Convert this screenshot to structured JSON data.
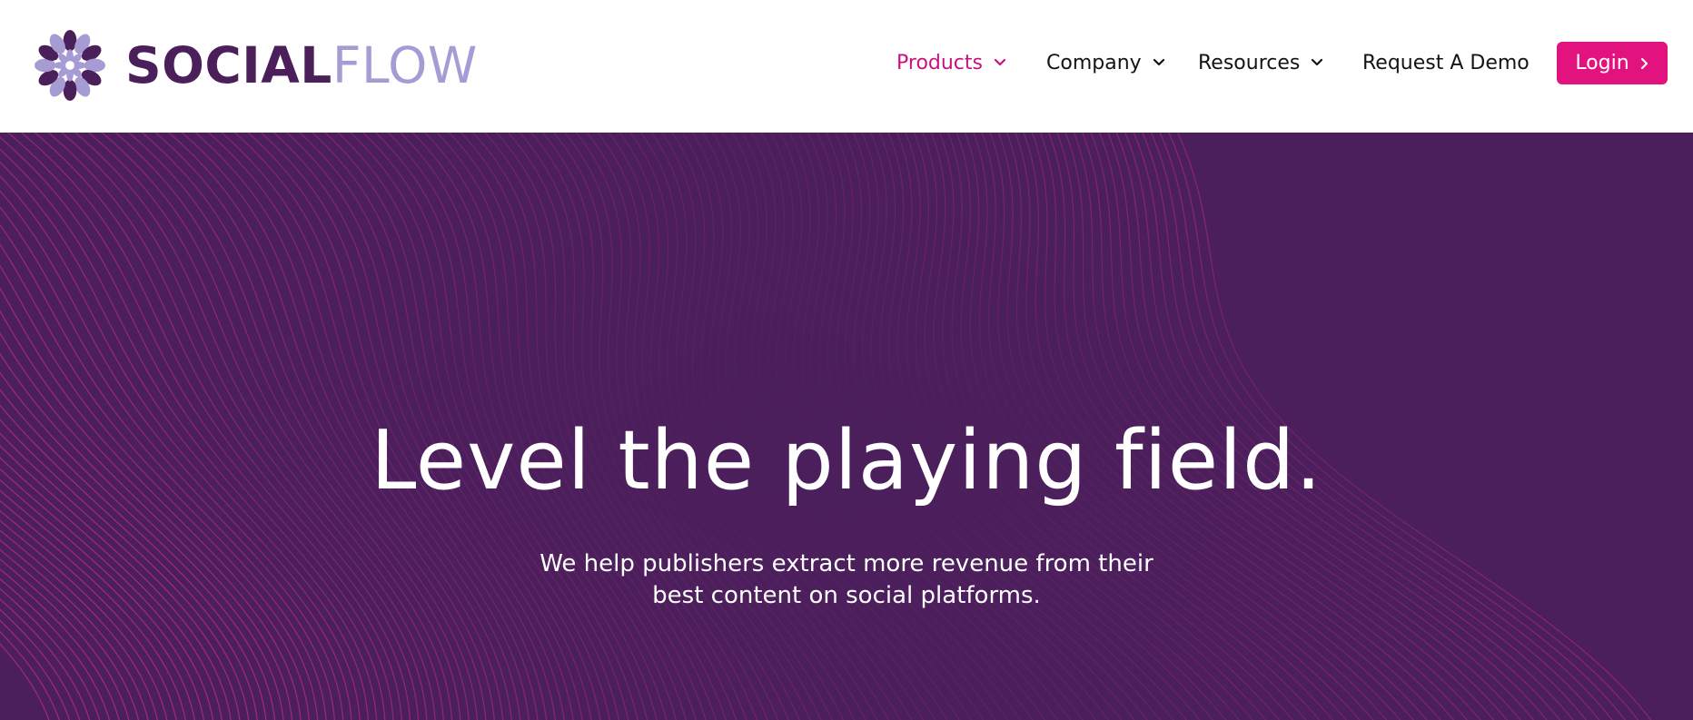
{
  "brand": {
    "name_part_1": "SOCIAL",
    "name_part_2": "FLOW",
    "primary_color": "#4b1f5a",
    "secondary_color": "#a79bd4",
    "logo_icon": "flower-logo-icon"
  },
  "nav": {
    "items": [
      {
        "label": "Products",
        "has_dropdown": true,
        "active": true
      },
      {
        "label": "Company",
        "has_dropdown": true,
        "active": false
      },
      {
        "label": "Resources",
        "has_dropdown": true,
        "active": false
      },
      {
        "label": "Request A Demo",
        "has_dropdown": false,
        "active": false
      }
    ],
    "login_label": "Login",
    "accent_color": "#e2127e",
    "active_color": "#c8127f"
  },
  "hero": {
    "title": "Level the playing field.",
    "subtitle_line_1": "We help publishers extract more revenue from their",
    "subtitle_line_2": "best content on social platforms.",
    "background_color": "#4a1f5b",
    "line_color": "#c02a86"
  }
}
